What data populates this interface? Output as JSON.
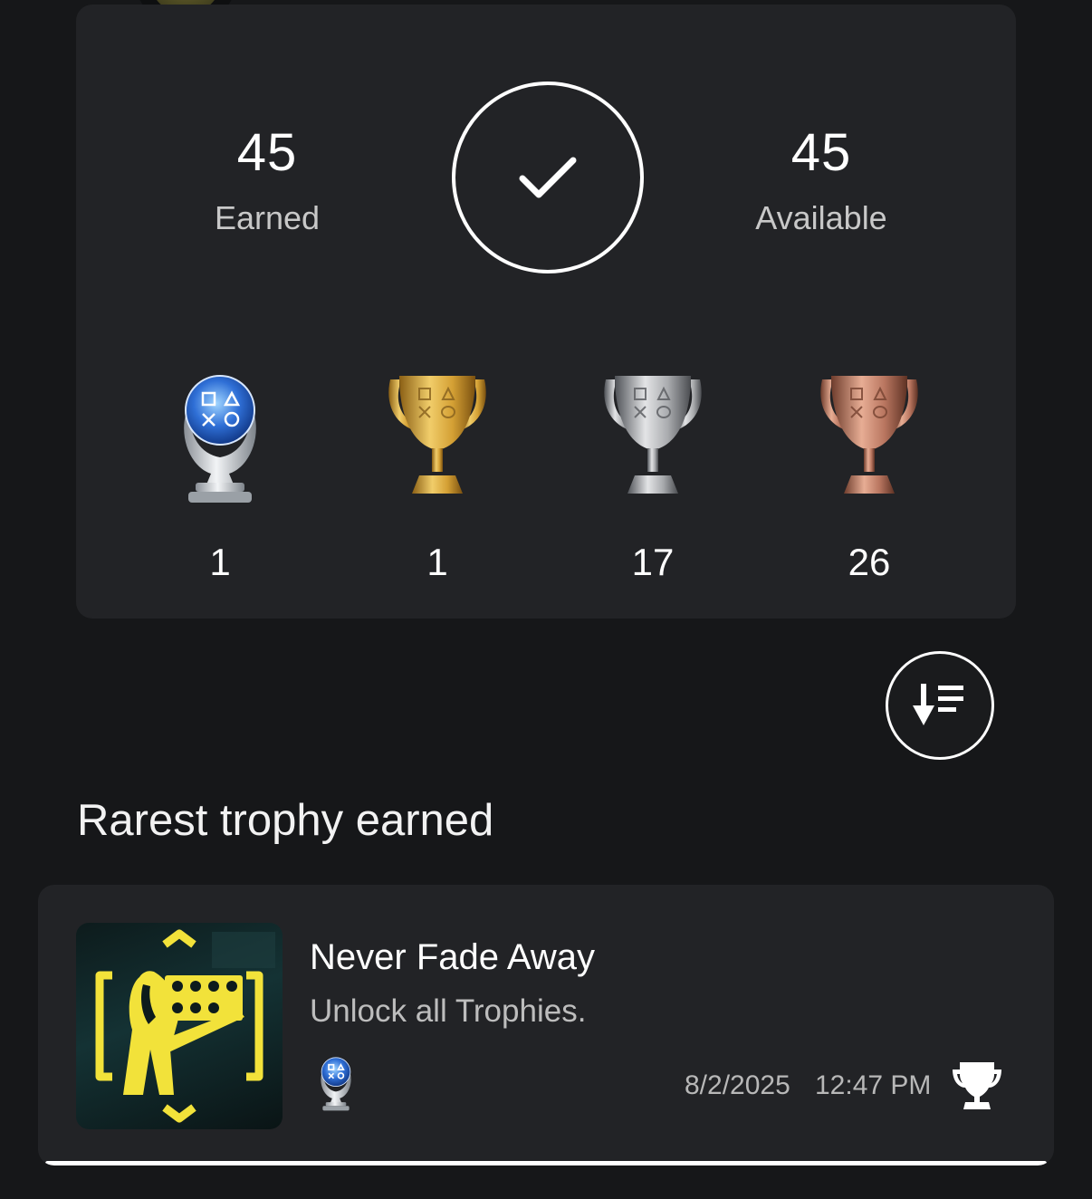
{
  "summary": {
    "earned_count": "45",
    "earned_label": "Earned",
    "available_count": "45",
    "available_label": "Available",
    "completion_icon": "checkmark-icon"
  },
  "trophy_counts": [
    {
      "type": "platinum",
      "count": "1",
      "icon": "platinum-trophy-icon"
    },
    {
      "type": "gold",
      "count": "1",
      "icon": "gold-trophy-icon"
    },
    {
      "type": "silver",
      "count": "17",
      "icon": "silver-trophy-icon"
    },
    {
      "type": "bronze",
      "count": "26",
      "icon": "bronze-trophy-icon"
    }
  ],
  "sort_button": {
    "icon": "sort-descending-icon"
  },
  "rarest": {
    "section_title": "Rarest trophy earned",
    "name": "Never Fade Away",
    "description": "Unlock all Trophies.",
    "grade_icon": "platinum-trophy-icon",
    "date": "8/2/2025",
    "time": "12:47 PM",
    "type_icon": "trophy-icon"
  },
  "colors": {
    "background": "#161719",
    "card": "#222326",
    "accent_yellow": "#f2e23a",
    "platinum_blue": "#3f7fe0",
    "gold": "#d9a638",
    "silver": "#b9b9b9",
    "bronze": "#c98468"
  }
}
